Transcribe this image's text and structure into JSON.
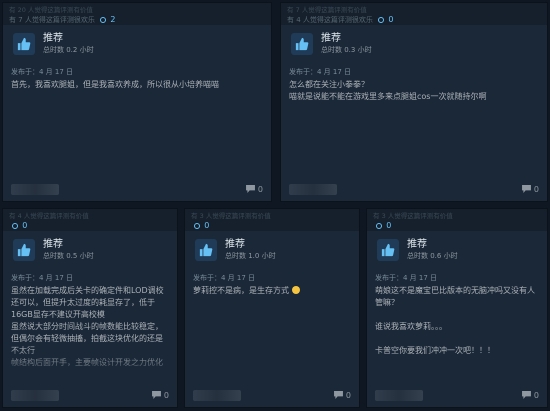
{
  "reviews": [
    {
      "helpful_line1": "有 20 人觉得这篇评测有价值",
      "helpful_line2": "有 7 人觉得这篇评测很欢乐",
      "award_count": "2",
      "recommendation": "推荐",
      "hours": "总时数 0.2 小时",
      "posted": "发布于：4 月 17 日",
      "body": "首先，我喜欢腿姐，但是我喜欢养成，所以很从小培养喵喵",
      "comments": "0",
      "truncated": false
    },
    {
      "helpful_line1": "有 7 人觉得这篇评测有价值",
      "helpful_line2": "有 4 人觉得这篇评测很欢乐",
      "award_count": "0",
      "recommendation": "推荐",
      "hours": "总时数 0.3 小时",
      "posted": "发布于：4 月 17 日",
      "body": "怎么都在关注小拳拳？\n喵就是说能不能在游戏里多来点腿姐cos一次就随持尔啊",
      "comments": "0",
      "truncated": false
    },
    {
      "helpful_line1": "有 4 人觉得这篇评测有价值",
      "helpful_line2": "",
      "award_count": "0",
      "recommendation": "推荐",
      "hours": "总时数 0.5 小时",
      "posted": "发布于：4 月 17 日",
      "body": "虽然在加载完成后关卡的确定件和LOD调校还可以，但提升太过度的耗显存了，低于16GB显存不建议开高校模\n虽然说大部分时间战斗的帧数能比较稳定，但偶尔会有轻微抽搐，拍截这块优化的还是不太行\n帧结构后面开手，主要帧设计开发之力优化",
      "comments": "0",
      "truncated": true
    },
    {
      "helpful_line1": "有 3 人觉得这篇评测有价值",
      "helpful_line2": "",
      "award_count": "0",
      "recommendation": "推荐",
      "hours": "总时数 1.0 小时",
      "posted": "发布于：4 月 17 日",
      "body": "萝莉控不是病，是生存方式",
      "comments": "0",
      "truncated": false
    },
    {
      "helpful_line1": "有 3 人觉得这篇评测有价值",
      "helpful_line2": "",
      "award_count": "0",
      "recommendation": "推荐",
      "hours": "总时数 0.6 小时",
      "posted": "发布于：4 月 17 日",
      "body": "萌娘这不是魔宝巴比版本的无脑冲吗又没有人管嘛？\n\n谁说我喜欢萝莉。。。\n\n卡普空你要我们冲冲一次吧！！！",
      "comments": "0",
      "truncated": false
    }
  ],
  "colors": {
    "page_bg": "#0f1722",
    "card_bg": "#1b2838",
    "accent": "#66c0f4",
    "thumb_bg": "#1f3b57"
  },
  "icons": {
    "thumb": "thumbs-up-icon",
    "award": "award-icon",
    "comment": "comment-icon"
  }
}
